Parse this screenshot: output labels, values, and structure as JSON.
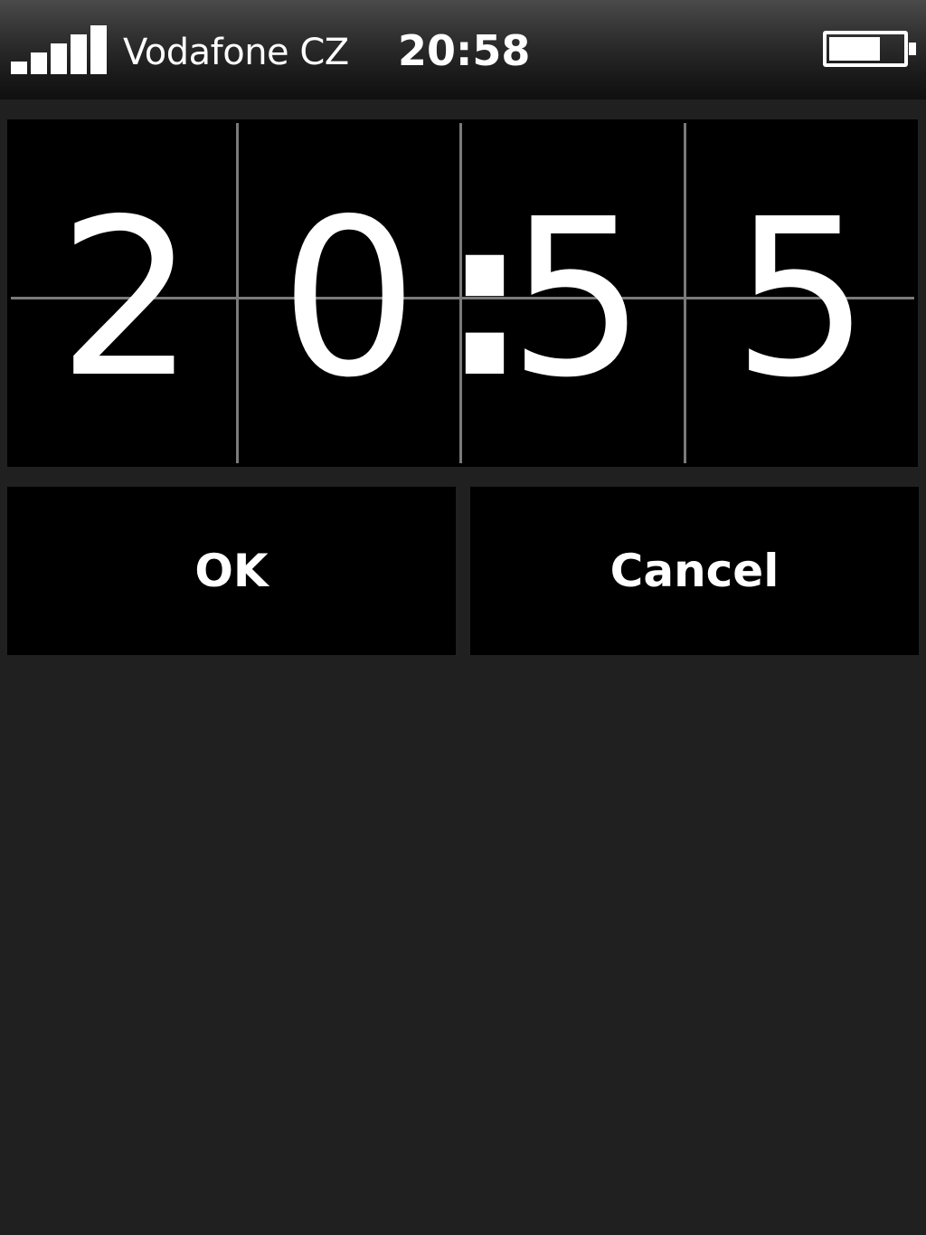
{
  "status_bar": {
    "carrier": "Vodafone CZ",
    "time": "20:58",
    "signal_bars": 5,
    "battery_level": 0.7,
    "signal_icon": "signal-strength-icon",
    "battery_icon": "battery-icon"
  },
  "time_picker": {
    "digits": [
      "2",
      "0",
      "5",
      "5"
    ],
    "separator": ":"
  },
  "buttons": {
    "ok_label": "OK",
    "cancel_label": "Cancel"
  },
  "colors": {
    "background": "#202020",
    "panel": "#000000",
    "text": "#ffffff",
    "grid_line": "#7a7a7a"
  }
}
